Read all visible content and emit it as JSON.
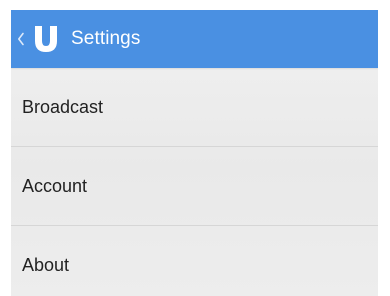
{
  "action_bar": {
    "title": "Settings",
    "background_color": "#4a90e2",
    "back_icon": "chevron-left-icon",
    "logo_icon": "u-logo-icon"
  },
  "menu": {
    "items": [
      {
        "label": "Broadcast"
      },
      {
        "label": "Account"
      },
      {
        "label": "About"
      }
    ]
  }
}
